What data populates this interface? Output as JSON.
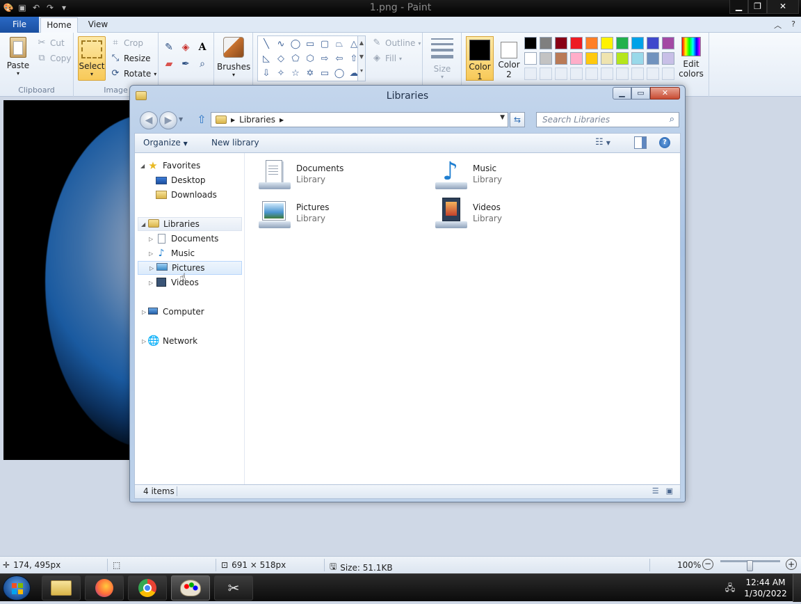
{
  "paint": {
    "window_title": "1.png - Paint",
    "quick_access": [
      "save-icon",
      "undo-icon",
      "redo-icon",
      "customize-icon"
    ],
    "tabs": [
      "File",
      "Home",
      "View"
    ],
    "ribbon": {
      "clipboard": {
        "paste": "Paste",
        "cut": "Cut",
        "copy": "Copy",
        "label": "Clipboard"
      },
      "image": {
        "select": "Select",
        "crop": "Crop",
        "resize": "Resize",
        "rotate": "Rotate",
        "label": "Image"
      },
      "brushes": "Brushes",
      "shapes": {
        "outline": "Outline",
        "fill": "Fill"
      },
      "size": "Size",
      "color1": [
        "Color",
        "1"
      ],
      "color2": [
        "Color",
        "2"
      ],
      "edit_colors": [
        "Edit",
        "colors"
      ],
      "palette_row1": [
        "#000000",
        "#7f7f7f",
        "#880015",
        "#ed1c24",
        "#ff7f27",
        "#fff200",
        "#22b14c",
        "#00a2e8",
        "#3f48cc",
        "#a349a4"
      ],
      "palette_row2": [
        "#ffffff",
        "#c3c3c3",
        "#b97a57",
        "#ffaec9",
        "#ffc90e",
        "#efe4b0",
        "#b5e61d",
        "#99d9ea",
        "#7092be",
        "#c8bfe7"
      ]
    },
    "status": {
      "cursor_pos": "174, 495px",
      "image_size": "691 × 518px",
      "file_size": "Size: 51.1KB",
      "zoom": "100%",
      "zoom_level": 1.0
    }
  },
  "explorer": {
    "title": "Libraries",
    "breadcrumb": [
      "Libraries"
    ],
    "search_placeholder": "Search Libraries",
    "toolbar": {
      "organize": "Organize",
      "new_library": "New library"
    },
    "nav": {
      "favorites": "Favorites",
      "favorites_items": [
        "Desktop",
        "Downloads"
      ],
      "libraries": "Libraries",
      "libraries_items": [
        "Documents",
        "Music",
        "Pictures",
        "Videos"
      ],
      "computer": "Computer",
      "network": "Network"
    },
    "items": [
      {
        "name": "Documents",
        "type": "Library"
      },
      {
        "name": "Music",
        "type": "Library"
      },
      {
        "name": "Pictures",
        "type": "Library"
      },
      {
        "name": "Videos",
        "type": "Library"
      }
    ],
    "status": "4 items"
  },
  "taskbar": {
    "apps": [
      "windows-explorer-icon",
      "firefox-icon",
      "chrome-icon",
      "paint-icon",
      "snipping-tool-icon"
    ],
    "time": "12:44 AM",
    "date": "1/30/2022"
  }
}
